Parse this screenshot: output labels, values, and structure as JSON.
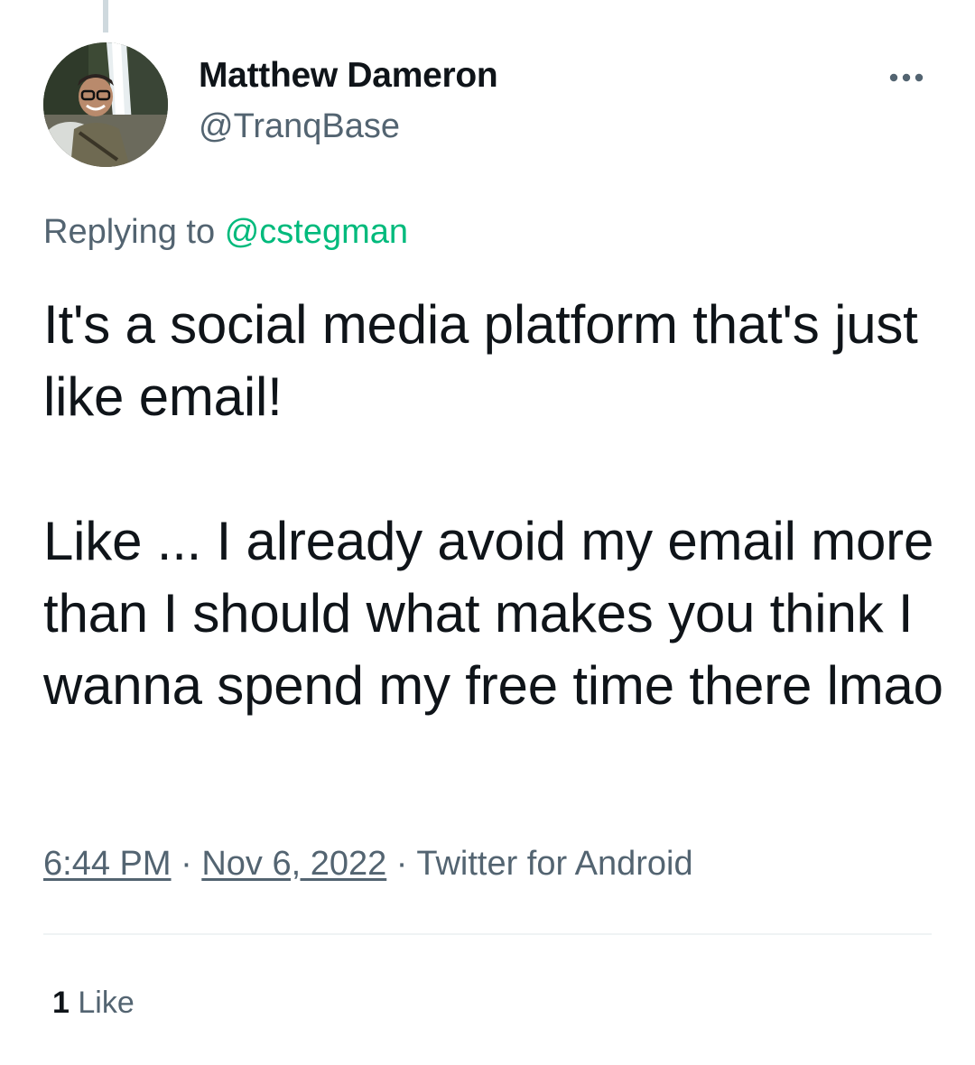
{
  "author": {
    "display_name": "Matthew Dameron",
    "handle": "@TranqBase",
    "avatar_icon": "user-avatar"
  },
  "reply": {
    "prefix": "Replying to",
    "mention": "@cstegman",
    "mention_color": "#00ba7c"
  },
  "tweet": {
    "text": "It's a social media platform that's just like email!\n\nLike ... I already avoid my email more than I should what makes you think I wanna spend my free time there lmao"
  },
  "meta": {
    "time": "6:44 PM",
    "dot1": "·",
    "date": "Nov 6, 2022",
    "dot2": "·",
    "source": "Twitter for Android"
  },
  "stats": {
    "likes_count": "1",
    "likes_label": "Like"
  },
  "menu": {
    "more_icon": "more-horizontal-icon"
  },
  "colors": {
    "text_primary": "#0f1419",
    "text_secondary": "#536471",
    "divider": "#eff3f4"
  }
}
